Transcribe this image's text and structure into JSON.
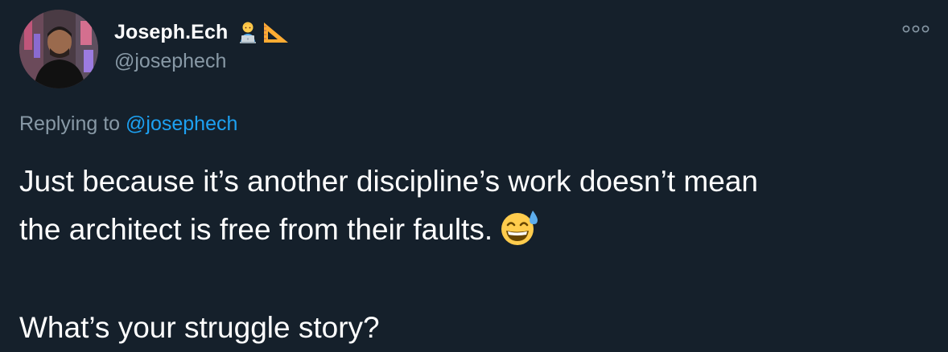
{
  "tweet": {
    "author": {
      "display_name": "Joseph.Ech",
      "handle": "@josephech",
      "name_emojis": [
        "technologist-emoji",
        "triangular-ruler-emoji"
      ],
      "avatar": "avatar-photo"
    },
    "more_icon": "more-horizontal-icon",
    "replying_prefix": "Replying to",
    "replying_mention": "@josephech",
    "body_line_1": "Just because it’s another discipline’s work doesn’t mean",
    "body_line_2": "the architect is free from their faults.",
    "body_line_2_emoji": "grinning-sweat-emoji",
    "body_line_3": "What’s your struggle story?"
  },
  "colors": {
    "background": "#15202b",
    "text_primary": "#ffffff",
    "text_secondary": "#8899a6",
    "link": "#1da1f2"
  }
}
